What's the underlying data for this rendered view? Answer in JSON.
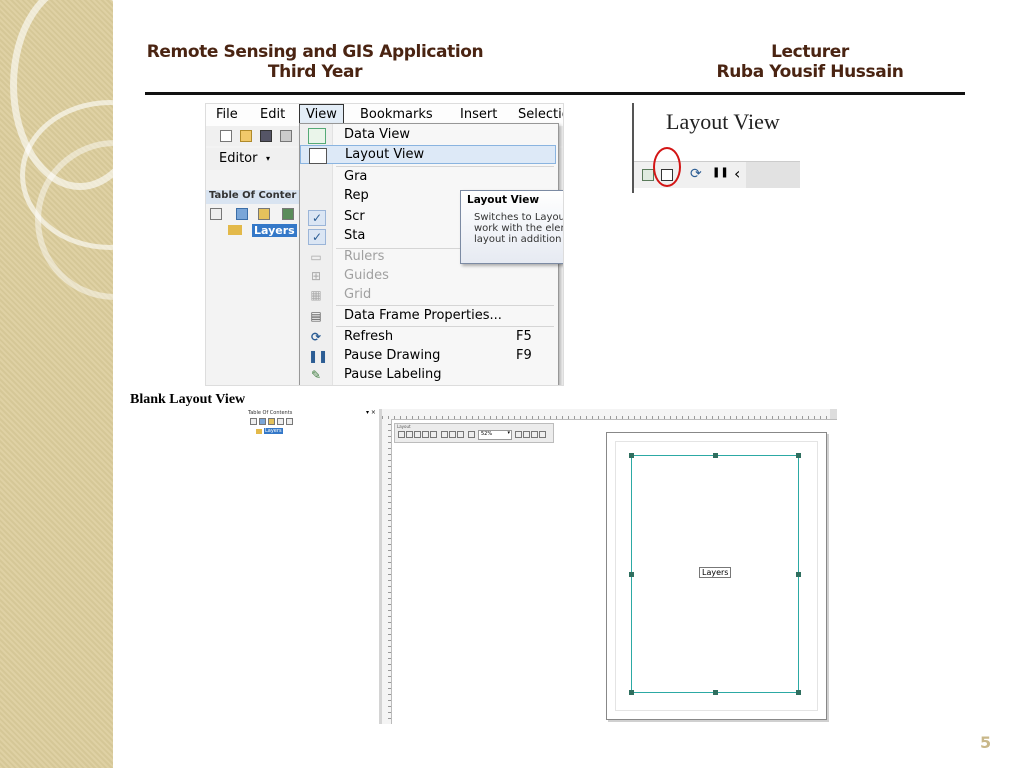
{
  "header": {
    "course_line1": "Remote Sensing and GIS Application",
    "course_line2": "Third Year",
    "lecturer_title": "Lecturer",
    "lecturer_name": "Ruba Yousif Hussain"
  },
  "menu_screenshot": {
    "menubar": [
      "File",
      "Edit",
      "View",
      "Bookmarks",
      "Insert",
      "Selection"
    ],
    "active_menu": "View",
    "editor_label": "Editor",
    "toc_label": "Table Of Conter",
    "layers_label": "Layers",
    "view_menu": {
      "items": [
        {
          "label": "Data View",
          "icon": "data-view-icon"
        },
        {
          "label": "Layout View",
          "icon": "layout-view-icon",
          "highlighted": true
        },
        {
          "label": "Gra",
          "icon": ""
        },
        {
          "label": "Rep",
          "icon": ""
        },
        {
          "label": "Scr",
          "icon": "check-icon"
        },
        {
          "label": "Sta",
          "icon": "check-icon"
        },
        {
          "label": "Rulers",
          "icon": "rulers-icon",
          "disabled": true
        },
        {
          "label": "Guides",
          "icon": "guides-icon",
          "disabled": true
        },
        {
          "label": "Grid",
          "icon": "grid-icon",
          "disabled": true
        },
        {
          "label": "Data Frame Properties...",
          "icon": "data-frame-properties-icon"
        },
        {
          "label": "Refresh",
          "icon": "refresh-icon",
          "shortcut": "F5"
        },
        {
          "label": "Pause Drawing",
          "icon": "pause-icon",
          "shortcut": "F9"
        },
        {
          "label": "Pause Labeling",
          "icon": "pause-labeling-icon"
        }
      ]
    },
    "tooltip": {
      "title": "Layout View",
      "body": "Switches to Layout view, which lets you work with the elements on your map layout in addition to the data it contains."
    }
  },
  "layout_view_screenshot": {
    "title": "Layout View"
  },
  "caption": "Blank Layout View",
  "layout_screenshot": {
    "toc_title": "Table Of Contents",
    "layers_label": "Layers",
    "toolbar_title": "Layout",
    "zoom_value": "52%",
    "data_frame_label": "Layers"
  },
  "page_number": "5"
}
